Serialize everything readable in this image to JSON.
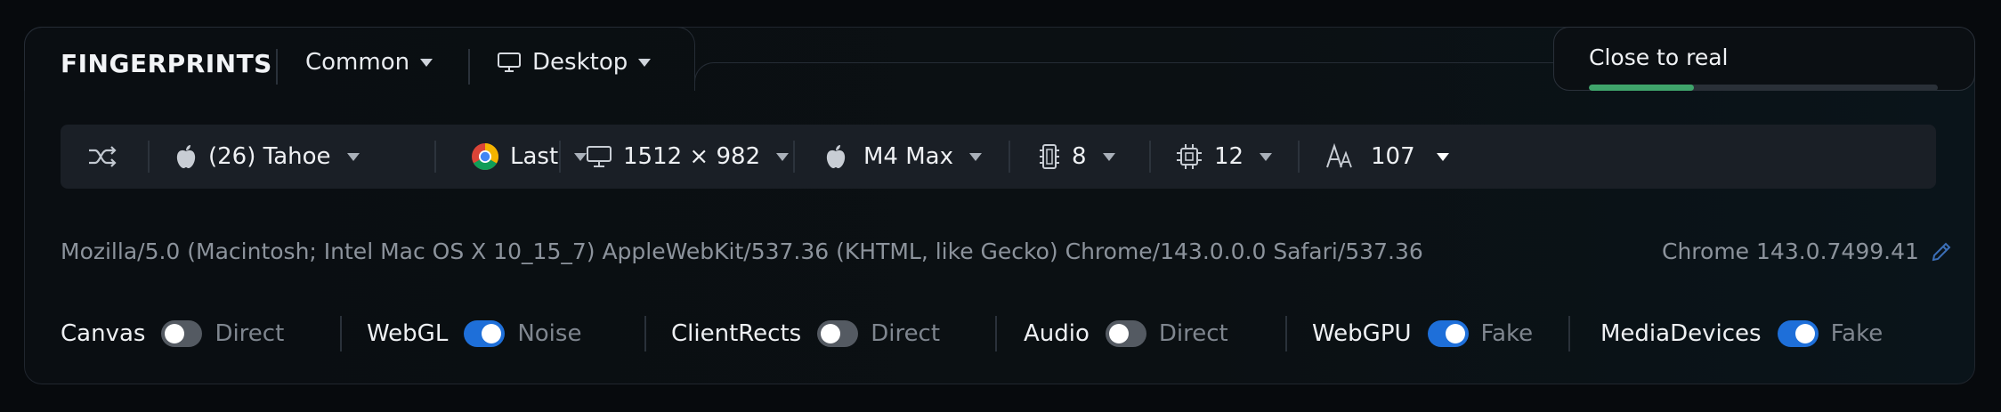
{
  "header": {
    "title": "FINGERPRINTS",
    "profile_dropdown": "Common",
    "device_dropdown": "Desktop"
  },
  "realness": {
    "label": "Close to real",
    "progress": 0.3,
    "bar_color": "#3fa46b"
  },
  "toolbar": {
    "shuffle_icon": "shuffle-icon",
    "os": {
      "icon": "apple-icon",
      "value": "(26) Tahoe"
    },
    "browser": {
      "icon": "chrome-icon",
      "value": "Last"
    },
    "resolution": {
      "icon": "monitor-icon",
      "value": "1512 × 982"
    },
    "cpu_model": {
      "icon": "apple-icon",
      "value": "M4 Max"
    },
    "memory": {
      "icon": "memory-icon",
      "value": "8"
    },
    "cores": {
      "icon": "cpu-icon",
      "value": "12"
    },
    "fonts": {
      "icon": "fonts-icon",
      "value": "107"
    }
  },
  "user_agent": "Mozilla/5.0 (Macintosh; Intel Mac OS X 10_15_7) AppleWebKit/537.36 (KHTML, like Gecko) Chrome/143.0.0.0 Safari/537.36",
  "browser_version": "Chrome 143.0.7499.41",
  "toggles": [
    {
      "label": "Canvas",
      "enabled": false,
      "mode": "Direct"
    },
    {
      "label": "WebGL",
      "enabled": true,
      "mode": "Noise"
    },
    {
      "label": "ClientRects",
      "enabled": false,
      "mode": "Direct"
    },
    {
      "label": "Audio",
      "enabled": false,
      "mode": "Direct"
    },
    {
      "label": "WebGPU",
      "enabled": true,
      "mode": "Fake"
    },
    {
      "label": "MediaDevices",
      "enabled": true,
      "mode": "Fake"
    }
  ],
  "colors": {
    "toggle_on": "#1e6fd9",
    "toggle_off": "#545a62",
    "accent_green": "#3fa46b"
  }
}
